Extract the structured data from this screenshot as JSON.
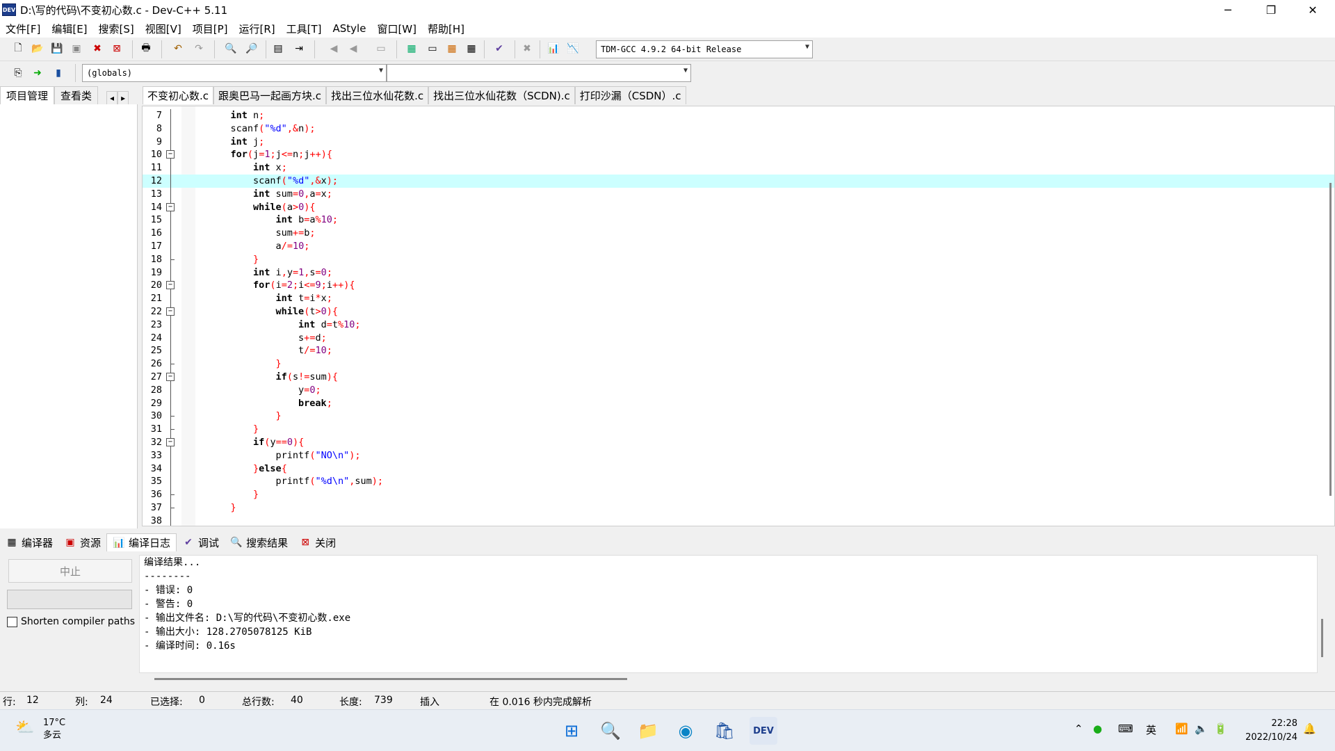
{
  "window": {
    "title": "D:\\写的代码\\不变初心数.c - Dev-C++ 5.11",
    "icon_label": "DEV",
    "controls": [
      "─",
      "❐",
      "✕"
    ]
  },
  "menu": [
    "文件[F]",
    "编辑[E]",
    "搜索[S]",
    "视图[V]",
    "项目[P]",
    "运行[R]",
    "工具[T]",
    "AStyle",
    "窗口[W]",
    "帮助[H]"
  ],
  "toolbar": {
    "compiler": "TDM-GCC 4.9.2 64-bit Release",
    "scope": "(globals)",
    "function": ""
  },
  "left_tabs": {
    "items": [
      "项目管理",
      "查看类"
    ],
    "nav_prev": "◂",
    "nav_next": "▸"
  },
  "editor_tabs": [
    "不变初心数.c",
    "跟奥巴马一起画方块.c",
    "找出三位水仙花数.c",
    "找出三位水仙花数（SCDN).c",
    "打印沙漏（CSDN）.c"
  ],
  "code_lines": [
    {
      "n": "7",
      "text": "    int n;"
    },
    {
      "n": "8",
      "text": "    scanf(\"%d\",&n);"
    },
    {
      "n": "9",
      "text": "    int j;"
    },
    {
      "n": "10",
      "text": "    for(j=1;j<=n;j++){"
    },
    {
      "n": "11",
      "text": "        int x;"
    },
    {
      "n": "12",
      "text": "        scanf(\"%d\",&x);"
    },
    {
      "n": "13",
      "text": "        int sum=0,a=x;"
    },
    {
      "n": "14",
      "text": "        while(a>0){"
    },
    {
      "n": "15",
      "text": "            int b=a%10;"
    },
    {
      "n": "16",
      "text": "            sum+=b;"
    },
    {
      "n": "17",
      "text": "            a/=10;"
    },
    {
      "n": "18",
      "text": "        }"
    },
    {
      "n": "19",
      "text": "        int i,y=1,s=0;"
    },
    {
      "n": "20",
      "text": "        for(i=2;i<=9;i++){"
    },
    {
      "n": "21",
      "text": "            int t=i*x;"
    },
    {
      "n": "22",
      "text": "            while(t>0){"
    },
    {
      "n": "23",
      "text": "                int d=t%10;"
    },
    {
      "n": "24",
      "text": "                s+=d;"
    },
    {
      "n": "25",
      "text": "                t/=10;"
    },
    {
      "n": "26",
      "text": "            }"
    },
    {
      "n": "27",
      "text": "            if(s!=sum){"
    },
    {
      "n": "28",
      "text": "                y=0;"
    },
    {
      "n": "29",
      "text": "                break;"
    },
    {
      "n": "30",
      "text": "            }"
    },
    {
      "n": "31",
      "text": "        }"
    },
    {
      "n": "32",
      "text": "        if(y==0){"
    },
    {
      "n": "33",
      "text": "            printf(\"NO\\n\");"
    },
    {
      "n": "34",
      "text": "        }else{"
    },
    {
      "n": "35",
      "text": "            printf(\"%d\\n\",sum);"
    },
    {
      "n": "36",
      "text": "        }"
    },
    {
      "n": "37",
      "text": "    }"
    },
    {
      "n": "38",
      "text": ""
    }
  ],
  "highlight_line": "12",
  "bottom_tabs": [
    "编译器",
    "资源",
    "编译日志",
    "调试",
    "搜索结果",
    "关闭"
  ],
  "bottom_panel": {
    "stop_label": "中止",
    "shorten_label": "Shorten compiler paths",
    "shorten_checked": false
  },
  "log": [
    "编译结果...",
    "--------",
    "- 错误: 0",
    "- 警告: 0",
    "- 输出文件名: D:\\写的代码\\不变初心数.exe",
    "- 输出大小: 128.2705078125 KiB",
    "- 编译时间: 0.16s"
  ],
  "status": {
    "row_label": "行:",
    "row": "12",
    "col_label": "列:",
    "col": "24",
    "sel_label": "已选择:",
    "sel": "0",
    "lines_label": "总行数:",
    "lines": "40",
    "len_label": "长度:",
    "len": "739",
    "mode": "插入",
    "parse": "在 0.016 秒内完成解析"
  },
  "taskbar": {
    "temp": "17°C",
    "weather": "多云",
    "ime": "英",
    "time": "22:28",
    "date": "2022/10/24"
  }
}
